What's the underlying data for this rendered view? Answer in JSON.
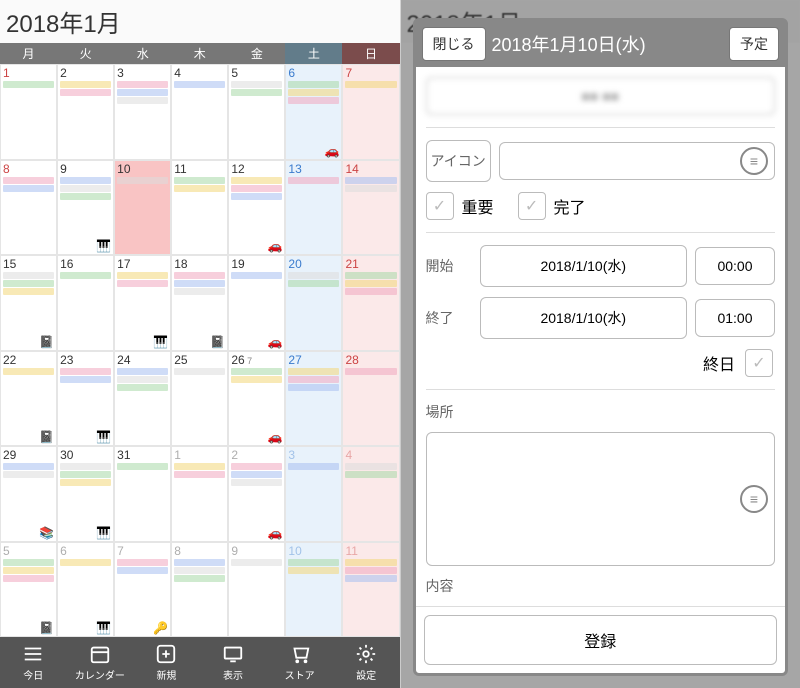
{
  "calendar": {
    "title": "2018年1月",
    "weekdays": [
      "月",
      "火",
      "水",
      "木",
      "金",
      "土",
      "日"
    ],
    "weeks": [
      [
        {
          "n": "1",
          "h": true
        },
        {
          "n": "2"
        },
        {
          "n": "3"
        },
        {
          "n": "4"
        },
        {
          "n": "5"
        },
        {
          "n": "6",
          "sat": true
        },
        {
          "n": "7",
          "sun": true
        }
      ],
      [
        {
          "n": "8",
          "h": true
        },
        {
          "n": "9"
        },
        {
          "n": "10",
          "today": true
        },
        {
          "n": "11"
        },
        {
          "n": "12"
        },
        {
          "n": "13",
          "sat": true
        },
        {
          "n": "14",
          "sun": true
        }
      ],
      [
        {
          "n": "15"
        },
        {
          "n": "16"
        },
        {
          "n": "17"
        },
        {
          "n": "18"
        },
        {
          "n": "19"
        },
        {
          "n": "20",
          "sat": true
        },
        {
          "n": "21",
          "sun": true
        }
      ],
      [
        {
          "n": "22"
        },
        {
          "n": "23"
        },
        {
          "n": "24"
        },
        {
          "n": "25"
        },
        {
          "n": "26",
          "sub": "7"
        },
        {
          "n": "27",
          "sat": true
        },
        {
          "n": "28",
          "sun": true
        }
      ],
      [
        {
          "n": "29"
        },
        {
          "n": "30"
        },
        {
          "n": "31"
        },
        {
          "n": "1",
          "dim": true
        },
        {
          "n": "2",
          "dim": true
        },
        {
          "n": "3",
          "sat": true,
          "dim": true
        },
        {
          "n": "4",
          "sun": true,
          "dim": true
        }
      ],
      [
        {
          "n": "5",
          "dim": true
        },
        {
          "n": "6",
          "dim": true
        },
        {
          "n": "7",
          "dim": true
        },
        {
          "n": "8",
          "dim": true
        },
        {
          "n": "9",
          "dim": true
        },
        {
          "n": "10",
          "sat": true,
          "dim": true
        },
        {
          "n": "11",
          "sun": true,
          "h": true,
          "dim": true
        }
      ]
    ],
    "icons": {
      "0-5": "🚗",
      "1-1": "🎹",
      "1-4": "🚗",
      "2-2": "🎹",
      "2-3": "📓",
      "2-4": "🚗",
      "2-0": "📓",
      "3-0": "📓",
      "3-1": "🎹",
      "3-4": "🚗",
      "4-0": "📚",
      "4-1": "🎹",
      "4-4": "🚗",
      "5-2": "🔑",
      "5-0": "📓",
      "5-1": "🎹"
    }
  },
  "toolbar": {
    "items": [
      {
        "name": "today",
        "label": "今日"
      },
      {
        "name": "calendar",
        "label": "カレンダー"
      },
      {
        "name": "new",
        "label": "新規"
      },
      {
        "name": "display",
        "label": "表示"
      },
      {
        "name": "store",
        "label": "ストア"
      },
      {
        "name": "settings",
        "label": "設定"
      }
    ]
  },
  "modal": {
    "close": "閉じる",
    "title": "2018年1月10日(水)",
    "type_btn": "予定",
    "title_placeholder": "　　",
    "icon_label": "アイコン",
    "important": "重要",
    "done": "完了",
    "start_lbl": "開始",
    "end_lbl": "終了",
    "start_date": "2018/1/10(水)",
    "start_time": "00:00",
    "end_date": "2018/1/10(水)",
    "end_time": "01:00",
    "allday": "終日",
    "place_lbl": "場所",
    "content_lbl": "内容",
    "submit": "登録"
  }
}
